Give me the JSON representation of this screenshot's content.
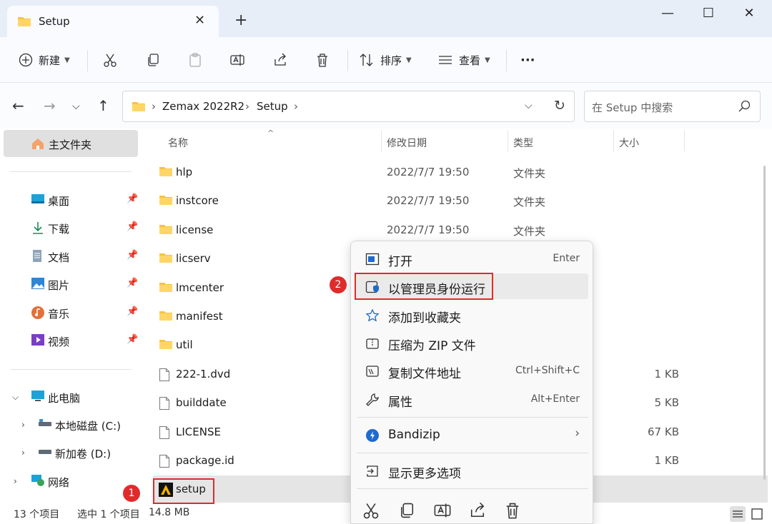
{
  "window": {
    "tab_title": "Setup",
    "tab_close": "✕",
    "new_tab": "+",
    "minimize": "—",
    "maximize": "☐",
    "close": "✕"
  },
  "toolbar": {
    "new_label": "新建",
    "sort_label": "排序",
    "view_label": "查看",
    "more_label": "···"
  },
  "address": {
    "crumbs": [
      "Zemax 2022R2",
      "Setup"
    ],
    "search_placeholder": "在 Setup 中搜索"
  },
  "sidebar": {
    "home": "主文件夹",
    "quick": [
      {
        "label": "桌面",
        "icon": "desktop-icon"
      },
      {
        "label": "下载",
        "icon": "download-icon"
      },
      {
        "label": "文档",
        "icon": "document-icon"
      },
      {
        "label": "图片",
        "icon": "pictures-icon"
      },
      {
        "label": "音乐",
        "icon": "music-icon"
      },
      {
        "label": "视频",
        "icon": "video-icon"
      }
    ],
    "this_pc": "此电脑",
    "drives": [
      "本地磁盘 (C:)",
      "新加卷 (D:)"
    ],
    "network": "网络"
  },
  "columns": {
    "name": "名称",
    "date": "修改日期",
    "type": "类型",
    "size": "大小"
  },
  "files": [
    {
      "name": "hlp",
      "date": "2022/7/7 19:50",
      "type": "文件夹",
      "size": "",
      "kind": "folder"
    },
    {
      "name": "instcore",
      "date": "2022/7/7 19:50",
      "type": "文件夹",
      "size": "",
      "kind": "folder"
    },
    {
      "name": "license",
      "date": "2022/7/7 19:50",
      "type": "文件夹",
      "size": "",
      "kind": "folder"
    },
    {
      "name": "licserv",
      "date": "",
      "type": "",
      "size": "",
      "kind": "folder"
    },
    {
      "name": "lmcenter",
      "date": "",
      "type": "",
      "size": "",
      "kind": "folder"
    },
    {
      "name": "manifest",
      "date": "",
      "type": "",
      "size": "",
      "kind": "folder"
    },
    {
      "name": "util",
      "date": "",
      "type": "",
      "size": "",
      "kind": "folder"
    },
    {
      "name": "222-1.dvd",
      "date": "",
      "type": "",
      "size": "1 KB",
      "kind": "file"
    },
    {
      "name": "builddate",
      "date": "",
      "type": "",
      "size": "5 KB",
      "kind": "file"
    },
    {
      "name": "LICENSE",
      "date": "",
      "type": "",
      "size": "67 KB",
      "kind": "file"
    },
    {
      "name": "package.id",
      "date": "",
      "type": "",
      "size": "1 KB",
      "kind": "file"
    },
    {
      "name": "setup",
      "date": "",
      "type": "",
      "size": "",
      "kind": "app"
    }
  ],
  "status": {
    "count": "13 个项目",
    "selected": "选中 1 个项目",
    "size": "14.8 MB"
  },
  "context_menu": {
    "items": [
      {
        "label": "打开",
        "key": "Enter",
        "icon": "open-icon"
      },
      {
        "label": "以管理员身份运行",
        "key": "",
        "icon": "shield-icon"
      },
      {
        "label": "添加到收藏夹",
        "key": "",
        "icon": "star-icon"
      },
      {
        "label": "压缩为 ZIP 文件",
        "key": "",
        "icon": "zip-icon"
      },
      {
        "label": "复制文件地址",
        "key": "Ctrl+Shift+C",
        "icon": "copy-path-icon"
      },
      {
        "label": "属性",
        "key": "Alt+Enter",
        "icon": "wrench-icon"
      },
      {
        "label": "Bandizip",
        "key": "›",
        "icon": "bandizip-icon"
      },
      {
        "label": "显示更多选项",
        "key": "",
        "icon": "more-options-icon"
      }
    ]
  },
  "annotations": {
    "badge1": "1",
    "badge2": "2"
  },
  "colors": {
    "accent": "#0067c0",
    "folder": "#f6c343",
    "annotation": "#e02b2b"
  }
}
